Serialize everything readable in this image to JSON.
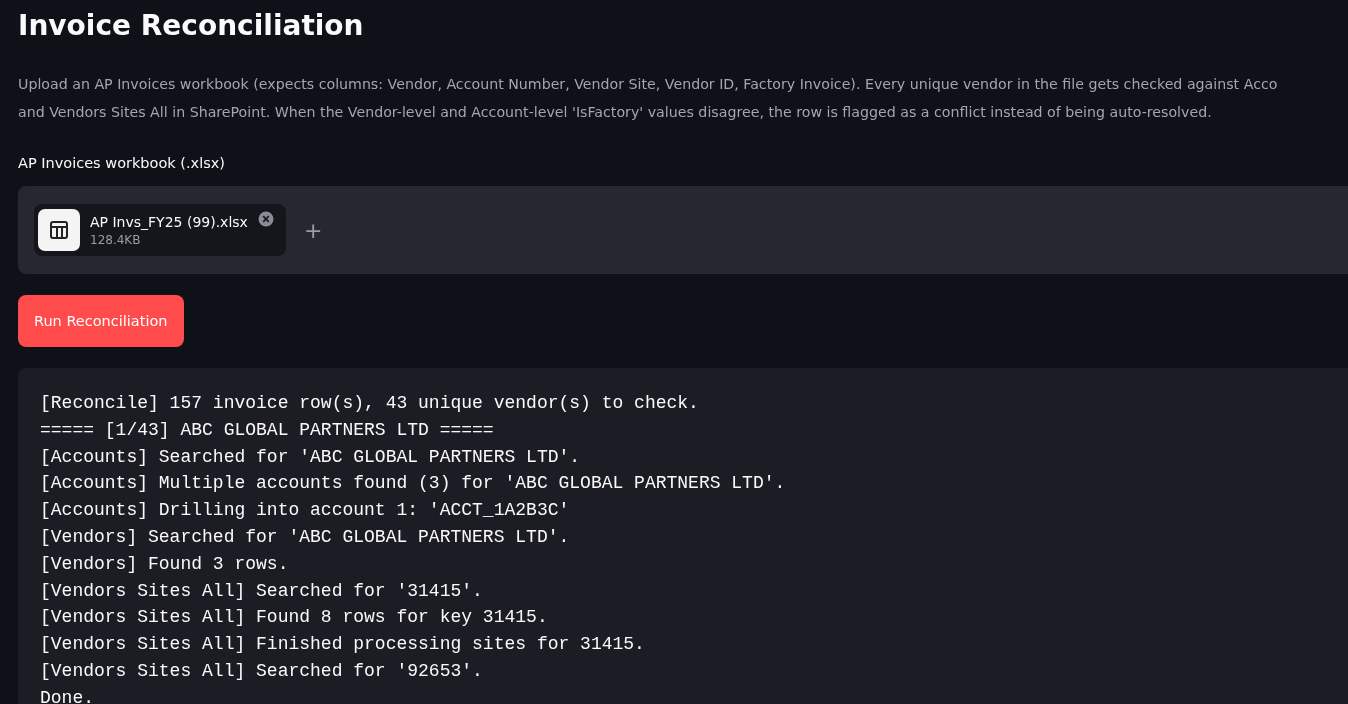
{
  "title": "Invoice Reconciliation",
  "description": [
    "Upload an AP Invoices workbook (expects columns: Vendor, Account Number, Vendor Site, Vendor ID, Factory Invoice). Every unique vendor in the file gets checked against Acco",
    "and Vendors Sites All in SharePoint. When the Vendor-level and Account-level 'IsFactory' values disagree, the row is flagged as a conflict instead of being auto-resolved."
  ],
  "uploader": {
    "label": "AP Invoices workbook (.xlsx)",
    "files": [
      {
        "name": "AP Invs_FY25 (99).xlsx",
        "size": "128.4KB"
      }
    ],
    "add": "+"
  },
  "run_button": "Run Reconciliation",
  "log": [
    "[Reconcile] 157 invoice row(s), 43 unique vendor(s) to check.",
    "===== [1/43] ABC GLOBAL PARTNERS LTD =====",
    "[Accounts] Searched for 'ABC GLOBAL PARTNERS LTD'.",
    "[Accounts] Multiple accounts found (3) for 'ABC GLOBAL PARTNERS LTD'.",
    "[Accounts] Drilling into account 1: 'ACCT_1A2B3C'",
    "[Vendors] Searched for 'ABC GLOBAL PARTNERS LTD'.",
    "[Vendors] Found 3 rows.",
    "[Vendors Sites All] Searched for '31415'.",
    "[Vendors Sites All] Found 8 rows for key 31415.",
    "[Vendors Sites All] Finished processing sites for 31415.",
    "[Vendors Sites All] Searched for '92653'.",
    "Done."
  ]
}
